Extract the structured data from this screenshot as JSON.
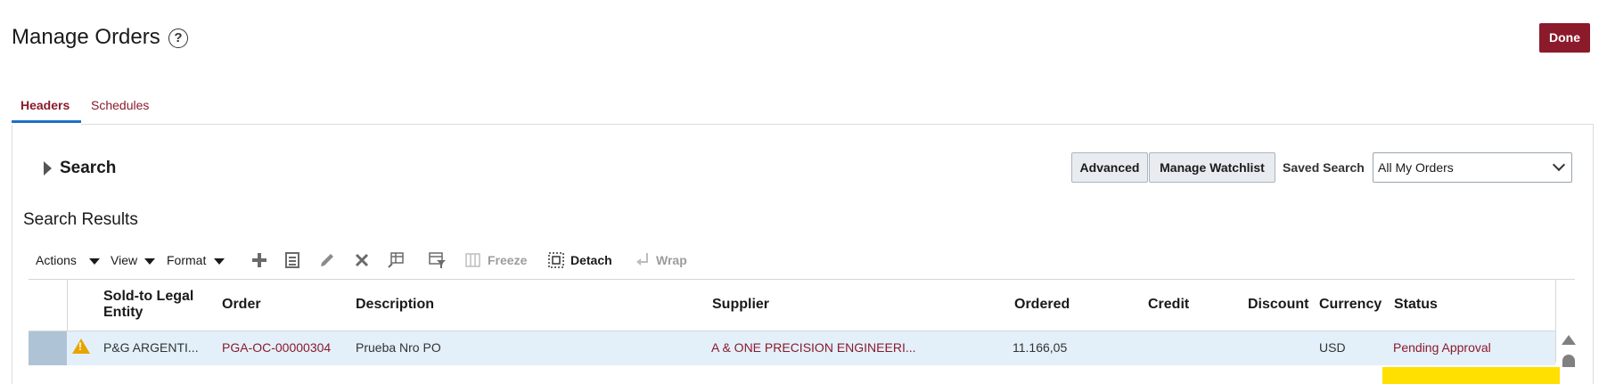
{
  "page": {
    "title": "Manage Orders",
    "done_label": "Done",
    "help_icon": "?"
  },
  "tabs": [
    {
      "label": "Headers",
      "active": true
    },
    {
      "label": "Schedules",
      "active": false
    }
  ],
  "search": {
    "title": "Search",
    "advanced_label": "Advanced",
    "watchlist_label": "Manage Watchlist",
    "saved_search_label": "Saved Search",
    "saved_search_value": "All My Orders"
  },
  "results": {
    "title": "Search Results",
    "toolbar": {
      "actions": "Actions",
      "view": "View",
      "format": "Format",
      "freeze": "Freeze",
      "detach": "Detach",
      "wrap": "Wrap",
      "icons": [
        "add-icon",
        "edit-record-icon",
        "pencil-icon",
        "delete-icon",
        "columns-icon",
        "query-by-example-icon",
        "freeze-icon",
        "detach-icon",
        "wrap-icon"
      ]
    },
    "columns": {
      "sold_to_line1": "Sold-to Legal",
      "sold_to_line2": "Entity",
      "order": "Order",
      "description": "Description",
      "supplier": "Supplier",
      "ordered": "Ordered",
      "credit": "Credit",
      "discount": "Discount",
      "currency": "Currency",
      "status": "Status"
    },
    "rows": [
      {
        "sold_to": "P&G ARGENTI...",
        "order": "PGA-OC-00000304",
        "description": "Prueba Nro PO",
        "supplier": "A & ONE PRECISION ENGINEERI...",
        "ordered": "11.166,05",
        "credit": "",
        "discount": "",
        "currency": "USD",
        "status": "Pending Approval",
        "warning": true
      }
    ]
  },
  "colors": {
    "accent": "#8b1a2b",
    "tab_underline": "#1f6fc6",
    "row_highlight": "#e3f0fa",
    "warning": "#e8a400",
    "marker": "#ffe000"
  }
}
